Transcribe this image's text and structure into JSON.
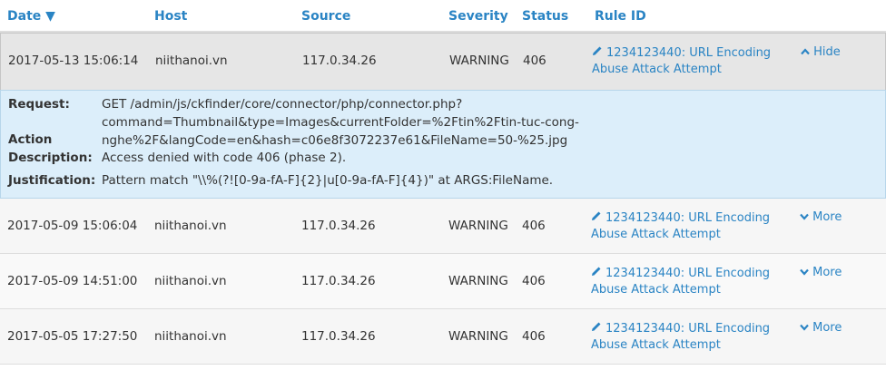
{
  "headers": {
    "date": "Date ▼",
    "host": "Host",
    "source": "Source",
    "severity": "Severity",
    "status": "Status",
    "rule_id": "Rule ID"
  },
  "expanded_row": {
    "date": "2017-05-13 15:06:14",
    "host": "niithanoi.vn",
    "source": "117.0.34.26",
    "severity": "WARNING",
    "status": "406",
    "rule_line1": "1234123440: URL Encoding",
    "rule_line2": "Abuse Attack Attempt",
    "action": "Hide",
    "action_icon": "chevron-up-icon"
  },
  "detail": {
    "request_label": "Request:",
    "request_value": "GET /admin/js/ckfinder/core/connector/php/connector.php?command=Thumbnail&type=Images&currentFolder=%2Ftin%2Ftin-tuc-cong-nghe%2F&langCode=en&hash=c06e8f3072237e61&FileName=50-%25.jpg",
    "action_label_1": "Action",
    "action_label_2": "Description:",
    "action_value": "Access denied with code 406 (phase 2).",
    "justification_label": "Justification:",
    "justification_value": "Pattern match \"\\\\%(?![0-9a-fA-F]{2}|u[0-9a-fA-F]{4})\" at ARGS:FileName."
  },
  "rows": [
    {
      "date": "2017-05-09 15:06:04",
      "host": "niithanoi.vn",
      "source": "117.0.34.26",
      "severity": "WARNING",
      "status": "406",
      "rule_line1": "1234123440: URL Encoding",
      "rule_line2": "Abuse Attack Attempt",
      "action": "More"
    },
    {
      "date": "2017-05-09 14:51:00",
      "host": "niithanoi.vn",
      "source": "117.0.34.26",
      "severity": "WARNING",
      "status": "406",
      "rule_line1": "1234123440: URL Encoding",
      "rule_line2": "Abuse Attack Attempt",
      "action": "More"
    },
    {
      "date": "2017-05-05 17:27:50",
      "host": "niithanoi.vn",
      "source": "117.0.34.26",
      "severity": "WARNING",
      "status": "406",
      "rule_line1": "1234123440: URL Encoding",
      "rule_line2": "Abuse Attack Attempt",
      "action": "More"
    }
  ],
  "colors": {
    "link": "#2a84c4",
    "detail_bg": "#dceefa",
    "expanded_bg": "#e6e6e6"
  }
}
